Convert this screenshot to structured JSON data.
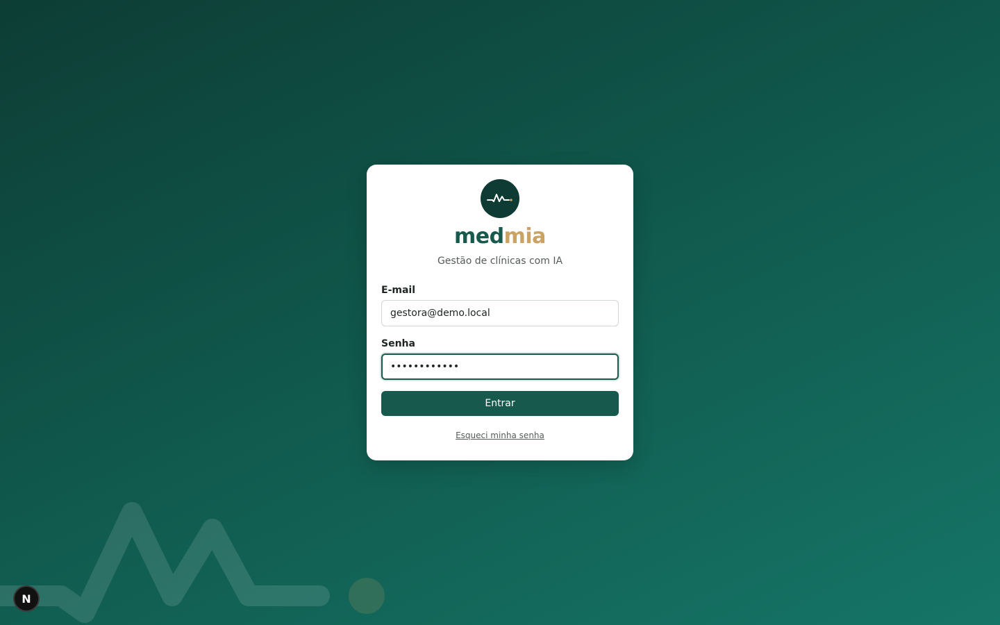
{
  "brand": {
    "part1": "med",
    "part2": "mia",
    "tagline": "Gestão de clínicas com IA",
    "logo_icon": "pulse-icon"
  },
  "form": {
    "email": {
      "label": "E-mail",
      "value": "gestora@demo.local"
    },
    "password": {
      "label": "Senha",
      "value": "••••••••••••"
    },
    "submit_label": "Entrar",
    "forgot_label": "Esqueci minha senha"
  },
  "badge": {
    "label": "N"
  },
  "colors": {
    "primary": "#175a4d",
    "accent": "#c9a264",
    "logo_bg": "#0e3b33"
  }
}
